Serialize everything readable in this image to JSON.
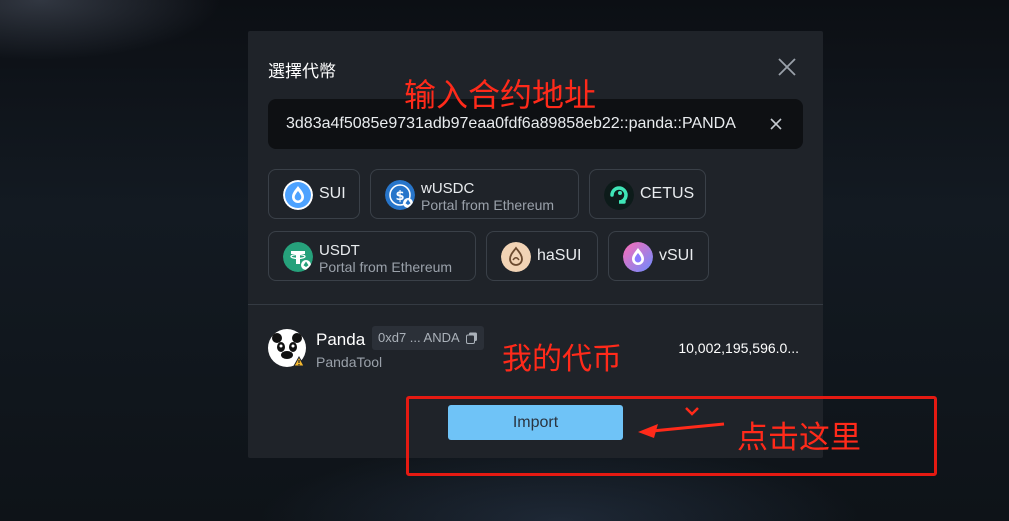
{
  "modal": {
    "title": "選擇代幣",
    "search": {
      "value": "3d83a4f5085e9731adb97eaa0fdf6a89858eb22::panda::PANDA"
    },
    "tokens": [
      {
        "symbol": "SUI",
        "logo_color": "#4da2ff"
      },
      {
        "symbol": "wUSDC",
        "subtitle": "Portal from Ethereum",
        "logo_color": "#2775ca"
      },
      {
        "symbol": "CETUS",
        "logo_color": "#0d1b1a"
      },
      {
        "symbol": "USDT",
        "subtitle": "Portal from Ethereum",
        "logo_color": "#26a17b"
      },
      {
        "symbol": "haSUI",
        "logo_color": "#f1d3b5"
      },
      {
        "symbol": "vSUI",
        "logo_color": "#9b6bff"
      }
    ],
    "result": {
      "name": "Panda",
      "address": "0xd7 ... ANDA",
      "source": "PandaTool",
      "balance": "10,002,195,596.0..."
    },
    "import_label": "Import"
  },
  "annotations": {
    "input_hint": "输入合约地址",
    "token_hint": "我的代币",
    "click_hint": "点击这里",
    "color": "#ff2a1a"
  }
}
